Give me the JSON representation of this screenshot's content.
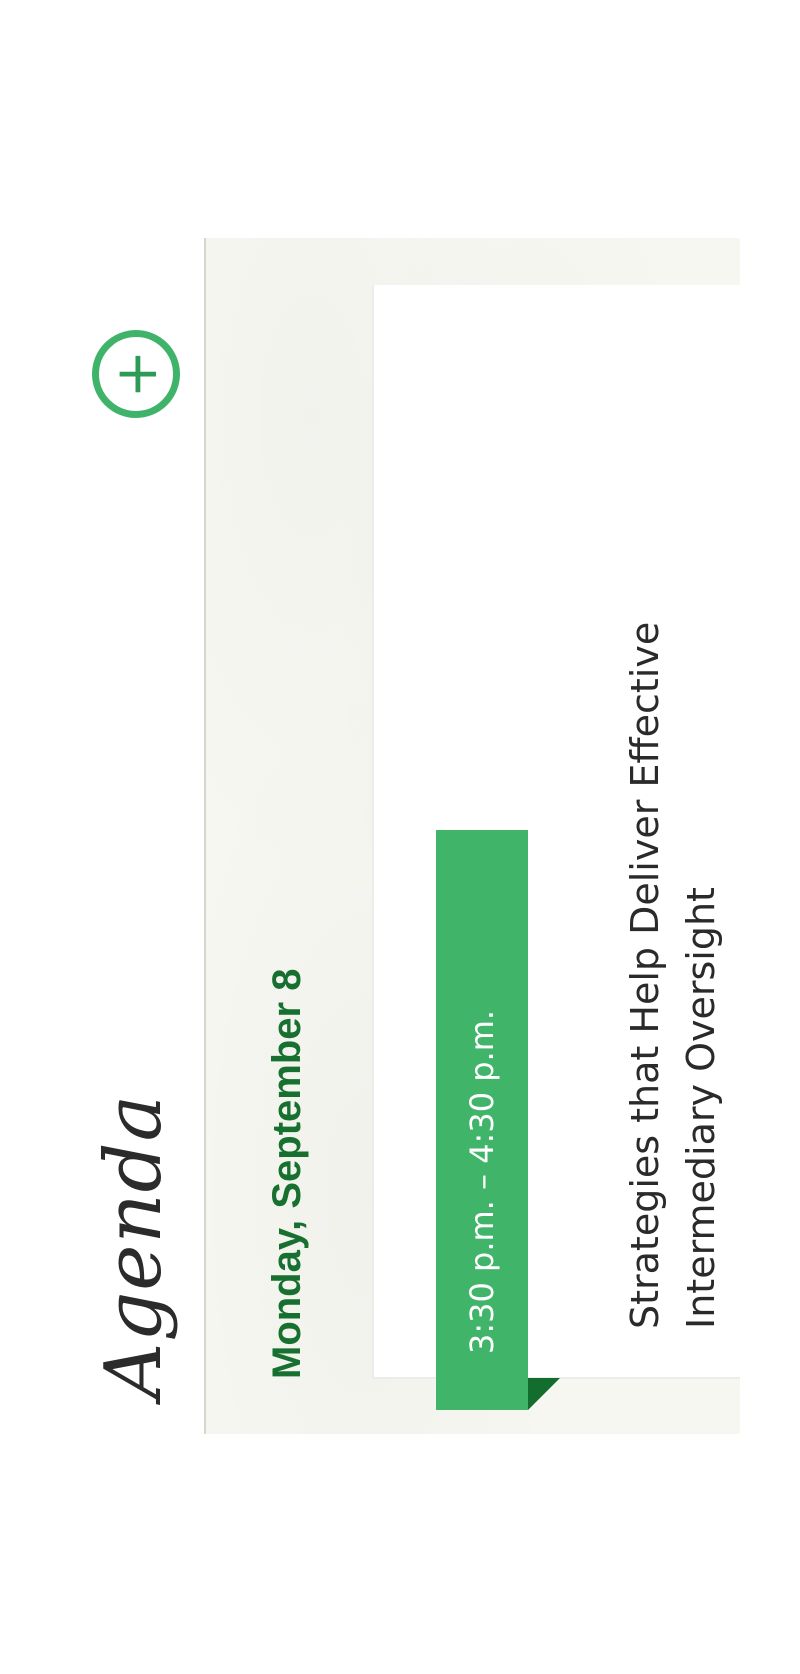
{
  "header": {
    "title": "Agenda",
    "add_button_symbol": "+",
    "add_button_icon": "plus-circle-icon",
    "accent_color": "#3fb36a"
  },
  "schedule": {
    "day_heading": "Monday, September 8",
    "day_heading_color": "#17702f",
    "sessions": [
      {
        "time": "3:30 p.m. – 4:30 p.m.",
        "title_line_1": "Strategies that Help Deliver Effective",
        "title_line_2": "Intermediary Oversight",
        "ribbon_color": "#40b56a",
        "ribbon_fold_color": "#136e2d"
      }
    ]
  }
}
